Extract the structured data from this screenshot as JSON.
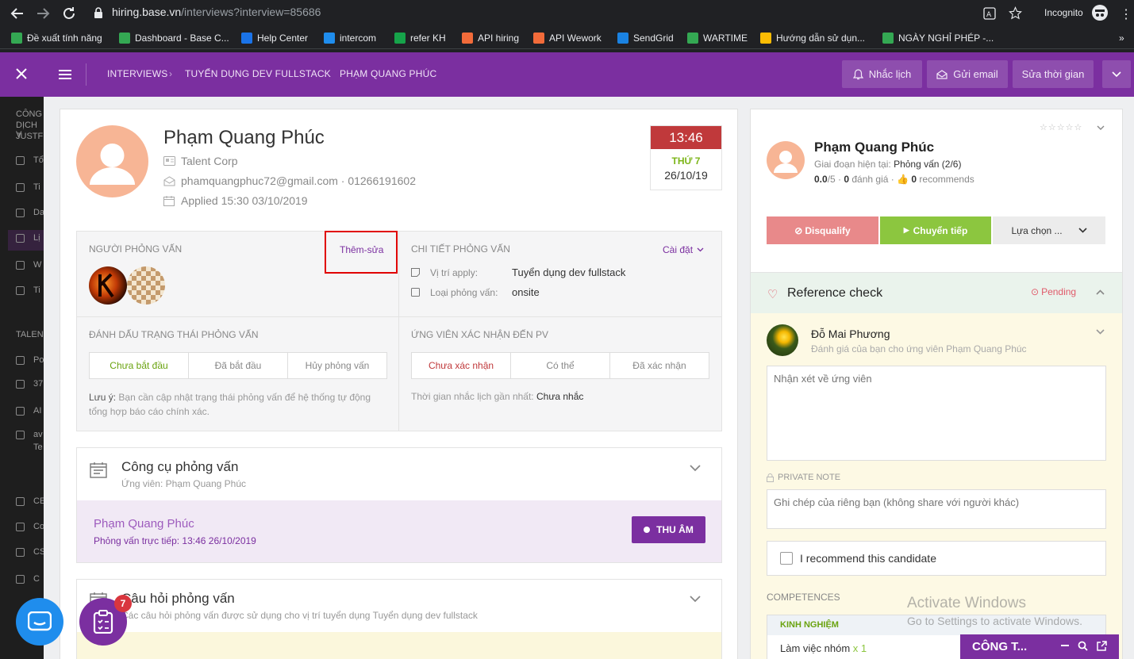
{
  "browser": {
    "url_host": "hiring.base.vn",
    "url_path": "/interviews?interview=85686",
    "incognito_label": "Incognito",
    "bookmarks": [
      {
        "label": "Đề xuất tính năng",
        "color": "#34a853"
      },
      {
        "label": "Dashboard - Base C...",
        "color": "#34a853"
      },
      {
        "label": "Help Center",
        "color": "#1a73e8"
      },
      {
        "label": "intercom",
        "color": "#1f8ded"
      },
      {
        "label": "refer KH",
        "color": "#16a34a"
      },
      {
        "label": "API hiring",
        "color": "#f26b3a"
      },
      {
        "label": "API Wework",
        "color": "#f26b3a"
      },
      {
        "label": "SendGrid",
        "color": "#1a82e2"
      },
      {
        "label": "WARTIME",
        "color": "#34a853"
      },
      {
        "label": "Hướng dẫn sử dụn...",
        "color": "#fbbc04"
      },
      {
        "label": "NGÀY NGHỈ PHÉP -...",
        "color": "#34a853"
      }
    ],
    "more": "»"
  },
  "header": {
    "breadcrumb": [
      "INTERVIEWS",
      "TUYỂN DỤNG DEV FULLSTACK",
      "PHẠM QUANG PHÚC"
    ],
    "buttons": {
      "remind": "Nhắc lịch",
      "email": "Gửi email",
      "edit_time": "Sửa thời gian"
    }
  },
  "sidebar_fragments": [
    "CÔNG",
    "DỊCH V",
    "JUSTF",
    "Tổ",
    "Ti",
    "Da",
    "Lị",
    "W",
    "Ti",
    "TALEN",
    "Po",
    "37",
    "AI",
    "av",
    "Te",
    "CE",
    "Co",
    "CS",
    "C"
  ],
  "candidate": {
    "name": "Phạm Quang Phúc",
    "company": "Talent Corp",
    "contact": "phamquangphuc72@gmail.com · 01266191602",
    "applied": "Applied 15:30 03/10/2019"
  },
  "schedule": {
    "time": "13:46",
    "weekday": "THỨ 7",
    "date": "26/10/19"
  },
  "interviewers": {
    "title": "NGƯỜI PHỎNG VẤN",
    "edit_link": "Thêm-sửa"
  },
  "details": {
    "title": "CHI TIẾT PHỎNG VẤN",
    "settings": "Cài đặt",
    "position_label": "Vị trí apply:",
    "position_value": "Tuyển dụng dev fullstack",
    "type_label": "Loại phỏng vấn:",
    "type_value": "onsite"
  },
  "status": {
    "title": "ĐÁNH DẤU TRẠNG THÁI PHỎNG VẤN",
    "tabs": [
      "Chưa bắt đầu",
      "Đã bắt đầu",
      "Hủy phỏng vấn"
    ],
    "note_label": "Lưu ý:",
    "note_text": " Bạn cần cập nhật trạng thái phỏng vấn để hệ thống tự động tổng hợp báo cáo chính xác."
  },
  "confirm": {
    "title": "ỨNG VIÊN XÁC NHẬN ĐẾN PV",
    "tabs": [
      "Chưa xác nhận",
      "Có thể",
      "Đã xác nhận"
    ],
    "reminder_label": "Thời gian nhắc lịch gần nhất:",
    "reminder_value": "Chưa nhắc"
  },
  "tools": {
    "title": "Công cụ phỏng vấn",
    "subtitle": "Ứng viên: Phạm Quang Phúc",
    "rec_name": "Phạm Quang Phúc",
    "rec_meta": "Phỏng vấn trực tiếp: 13:46 26/10/2019",
    "record_button": "THU ÂM"
  },
  "questions": {
    "title": "Câu hỏi phỏng vấn",
    "subtitle": "Các câu hỏi phỏng vấn được sử dụng cho vị trí tuyển dụng Tuyển dụng dev fullstack"
  },
  "right": {
    "name": "Phạm Quang Phúc",
    "stage_label": "Giai đoạn hiện tại:",
    "stage_value": "Phỏng vấn (2/6)",
    "score": "0.0",
    "score_max": "/5 · ",
    "reviews_count": "0",
    "reviews_label": " đánh giá · ",
    "recommend_count": "0",
    "recommend_label": " recommends",
    "disqualify": "Disqualify",
    "forward": "Chuyển tiếp",
    "choose": "Lựa chọn ...",
    "reference_title": "Reference check",
    "reference_status": "Pending",
    "reviewer_name": "Đỗ Mai Phương",
    "reviewer_sub": "Đánh giá của bạn cho ứng viên Phạm Quang Phúc",
    "comment_placeholder": "Nhận xét về ứng viên",
    "private_label": "PRIVATE NOTE",
    "private_placeholder": "Ghi chép của riêng bạn (không share với người khác)",
    "recommend_check": "I recommend this candidate",
    "competences": "COMPETENCES",
    "exp_title": "KINH NGHIỆM",
    "skill": "Làm việc nhóm",
    "skill_mult": "x 1"
  },
  "overlays": {
    "activate_title": "Activate Windows",
    "activate_sub": "Go to Settings to activate Windows.",
    "badge": "7",
    "chat_title": "CÔNG T..."
  },
  "colors": {
    "brand": "#7b2fa0",
    "time_header": "#c0393b",
    "weekday": "#7cb518",
    "forward": "#8cc63f",
    "disqualify": "#e8898a",
    "highlight_box": "#e00000"
  }
}
